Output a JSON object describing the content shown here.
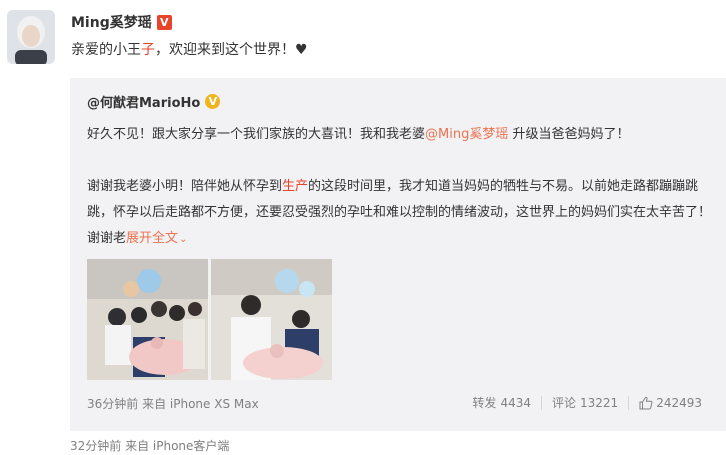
{
  "post": {
    "author": "Ming奚梦瑶",
    "verified_badge": "V",
    "text_before": "亲爱的小王",
    "text_highlight": "子",
    "text_after": "，欢迎来到这个世界！",
    "heart": "♥",
    "meta": "32分钟前  来自 iPhone客户端"
  },
  "repost": {
    "author": "@何猷君MarioHo",
    "verified_badge": "V",
    "line1_before": "好久不见！跟大家分享一个我们家族的大喜讯！我和我老婆",
    "line1_mention": "@Ming奚梦瑶",
    "line1_after": " 升级当爸爸妈妈了！",
    "para_part1": "谢谢我老婆小明！陪伴她从怀孕到",
    "para_highlight": "生产",
    "para_part2": "的这段时间里，我才知道当妈妈的牺牲与不易。以前她走路都蹦蹦跳跳，怀孕以后走路都不方便，还要忍受强烈的孕吐和难以控制的情绪波动，这世界上的妈妈们实在太辛苦了！谢谢老",
    "expand": "展开全文",
    "meta": "36分钟前 来自 iPhone XS Max",
    "repost_label": "转发",
    "repost_count": "4434",
    "comment_label": "评论",
    "comment_count": "13221",
    "like_count": "242493"
  },
  "colors": {
    "accent_link": "#eb7350",
    "highlight_red": "#e8432b",
    "badge_gold": "#f0b51a",
    "repost_bg": "#f2f2f5"
  }
}
